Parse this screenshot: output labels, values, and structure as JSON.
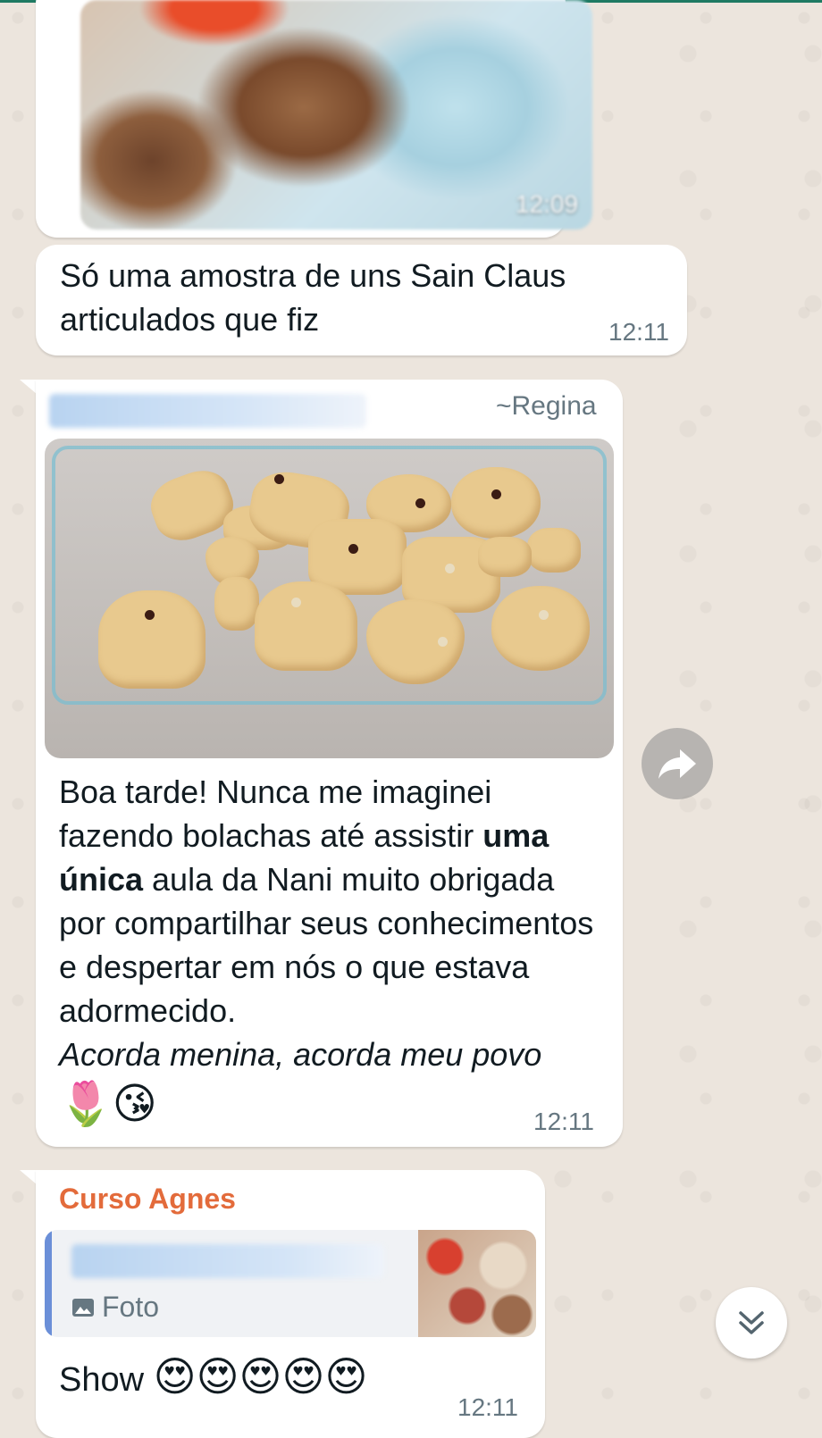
{
  "messages": [
    {
      "image_time": "12:09"
    },
    {
      "text": "Só uma amostra de uns Sain Claus articulados que fiz",
      "time": "12:11"
    },
    {
      "sender_name": "~Regina",
      "text_part1": "Boa tarde! Nunca me imaginei fazendo bolachas até assistir ",
      "text_bold": "uma única",
      "text_part2": " aula da Nani muito obrigada por compartilhar seus conhecimentos e despertar em nós o que estava adormecido.",
      "text_italic": "Acorda menina, acorda meu povo",
      "emojis": "🌷😘",
      "time": "12:11"
    },
    {
      "sender_name": "Curso Agnes",
      "quote_label": "Foto",
      "text": "Show",
      "emojis": "😍😍😍😍😍",
      "time": "12:11"
    }
  ],
  "icons": [
    "forward-icon",
    "photo-icon",
    "double-chevron-down-icon"
  ],
  "colors": {
    "sender_agnes": "#e36b3b",
    "time": "#667781",
    "quote_bar": "#6b8fd8",
    "top_line": "#1f7a63"
  }
}
